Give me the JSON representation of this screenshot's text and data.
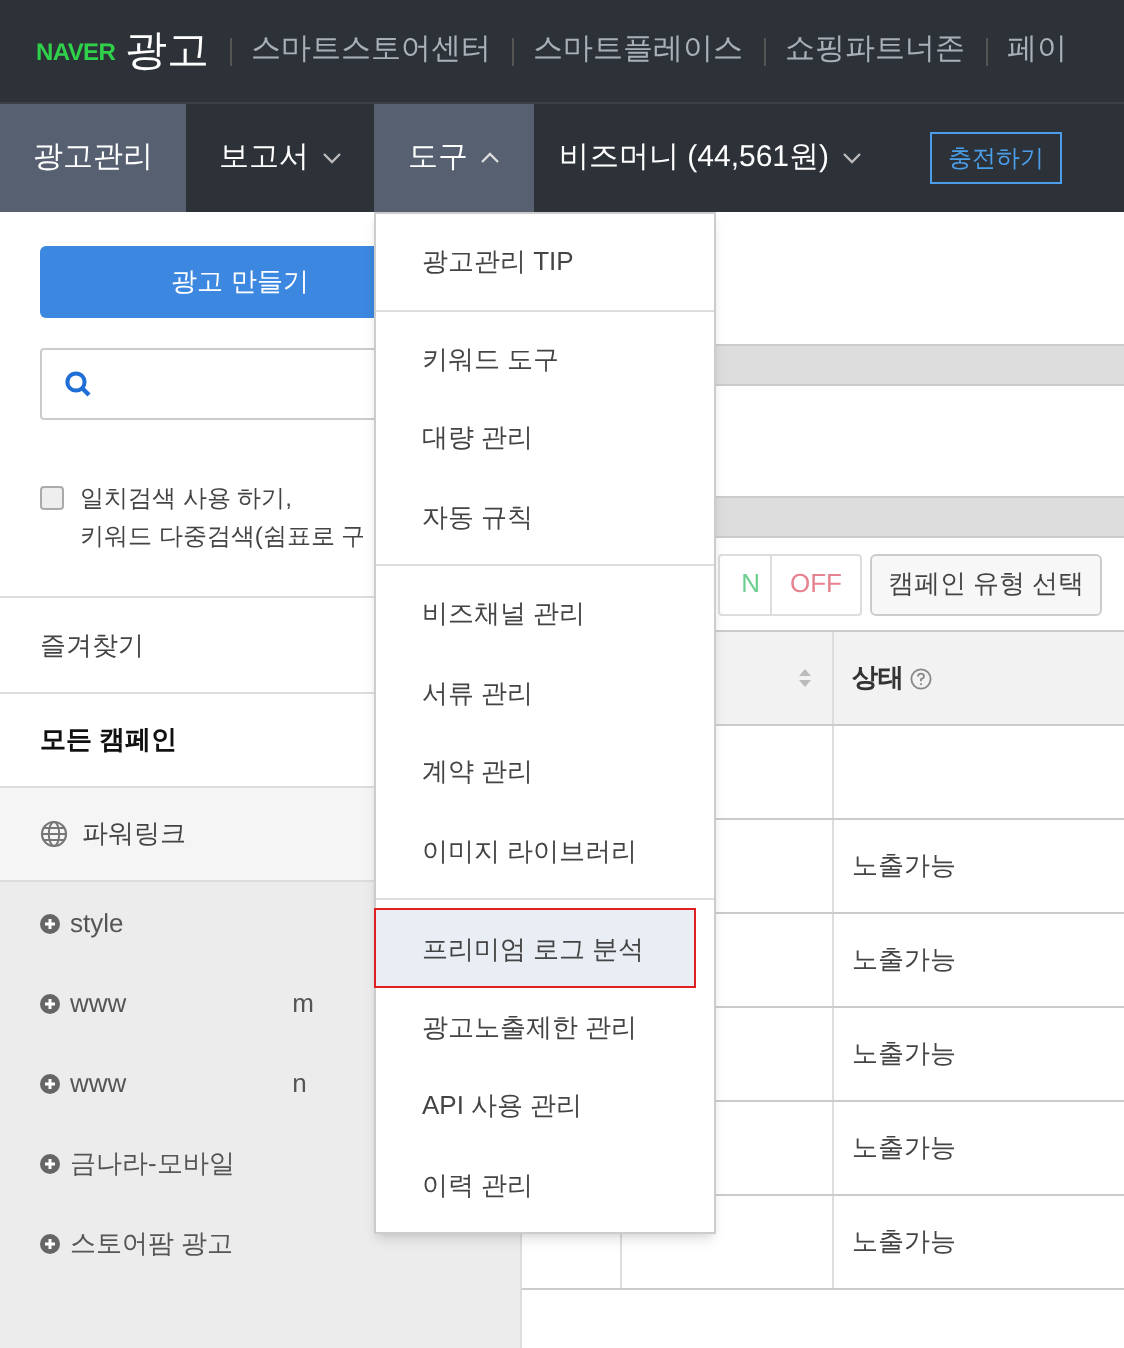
{
  "header": {
    "logo": "NAVER",
    "title": "광고",
    "links": [
      "스마트스토어센터",
      "스마트플레이스",
      "쇼핑파트너존",
      "페이"
    ]
  },
  "nav": [
    {
      "label": "광고관리",
      "kind": "link",
      "selected": true
    },
    {
      "label": "보고서",
      "kind": "menu",
      "expanded": false
    },
    {
      "label": "도구",
      "kind": "menu",
      "expanded": true
    },
    {
      "label": "비즈머니 (44,561원)",
      "kind": "menu",
      "expanded": false
    }
  ],
  "charge_button": "충전하기",
  "sidebar": {
    "create_button": "광고 만들기",
    "exact_search": {
      "checked": false,
      "label": "일치검색 사용 하기,",
      "label_2": "키워드 다중검색(쉼표로 구"
    },
    "favorites": "즐겨찾기",
    "all_campaigns": "모든 캠페인",
    "group": "파워링크",
    "items": [
      {
        "label": "style"
      },
      {
        "label": "www",
        "suffix": "m"
      },
      {
        "label": "www",
        "suffix": "n"
      },
      {
        "label": "금나라-모바일"
      },
      {
        "label": "스토어팜 광고"
      }
    ]
  },
  "toolbar": {
    "on": "N",
    "off": "OFF",
    "campaign_type": "캠페인 유형 선택"
  },
  "table": {
    "columns": [
      "상태"
    ],
    "rows": [
      {
        "status": ""
      },
      {
        "status": "노출가능"
      },
      {
        "status": "노출가능"
      },
      {
        "status": "노출가능"
      },
      {
        "status": "노출가능"
      },
      {
        "status": "노출가능"
      }
    ]
  },
  "menu": [
    [
      {
        "label": "광고관리 TIP",
        "selected": false
      }
    ],
    [
      {
        "label": "키워드 도구",
        "selected": false
      },
      {
        "label": "대량 관리",
        "selected": false
      },
      {
        "label": "자동 규칙",
        "selected": false
      }
    ],
    [
      {
        "label": "비즈채널 관리",
        "selected": false
      },
      {
        "label": "서류 관리",
        "selected": false
      },
      {
        "label": "계약 관리",
        "selected": false
      },
      {
        "label": "이미지 라이브러리",
        "selected": false
      }
    ],
    [
      {
        "label": "프리미엄 로그 분석",
        "selected": true
      },
      {
        "label": "광고노출제한 관리",
        "selected": false
      },
      {
        "label": "API 사용 관리",
        "selected": false
      },
      {
        "label": "이력 관리",
        "selected": false
      }
    ]
  ]
}
